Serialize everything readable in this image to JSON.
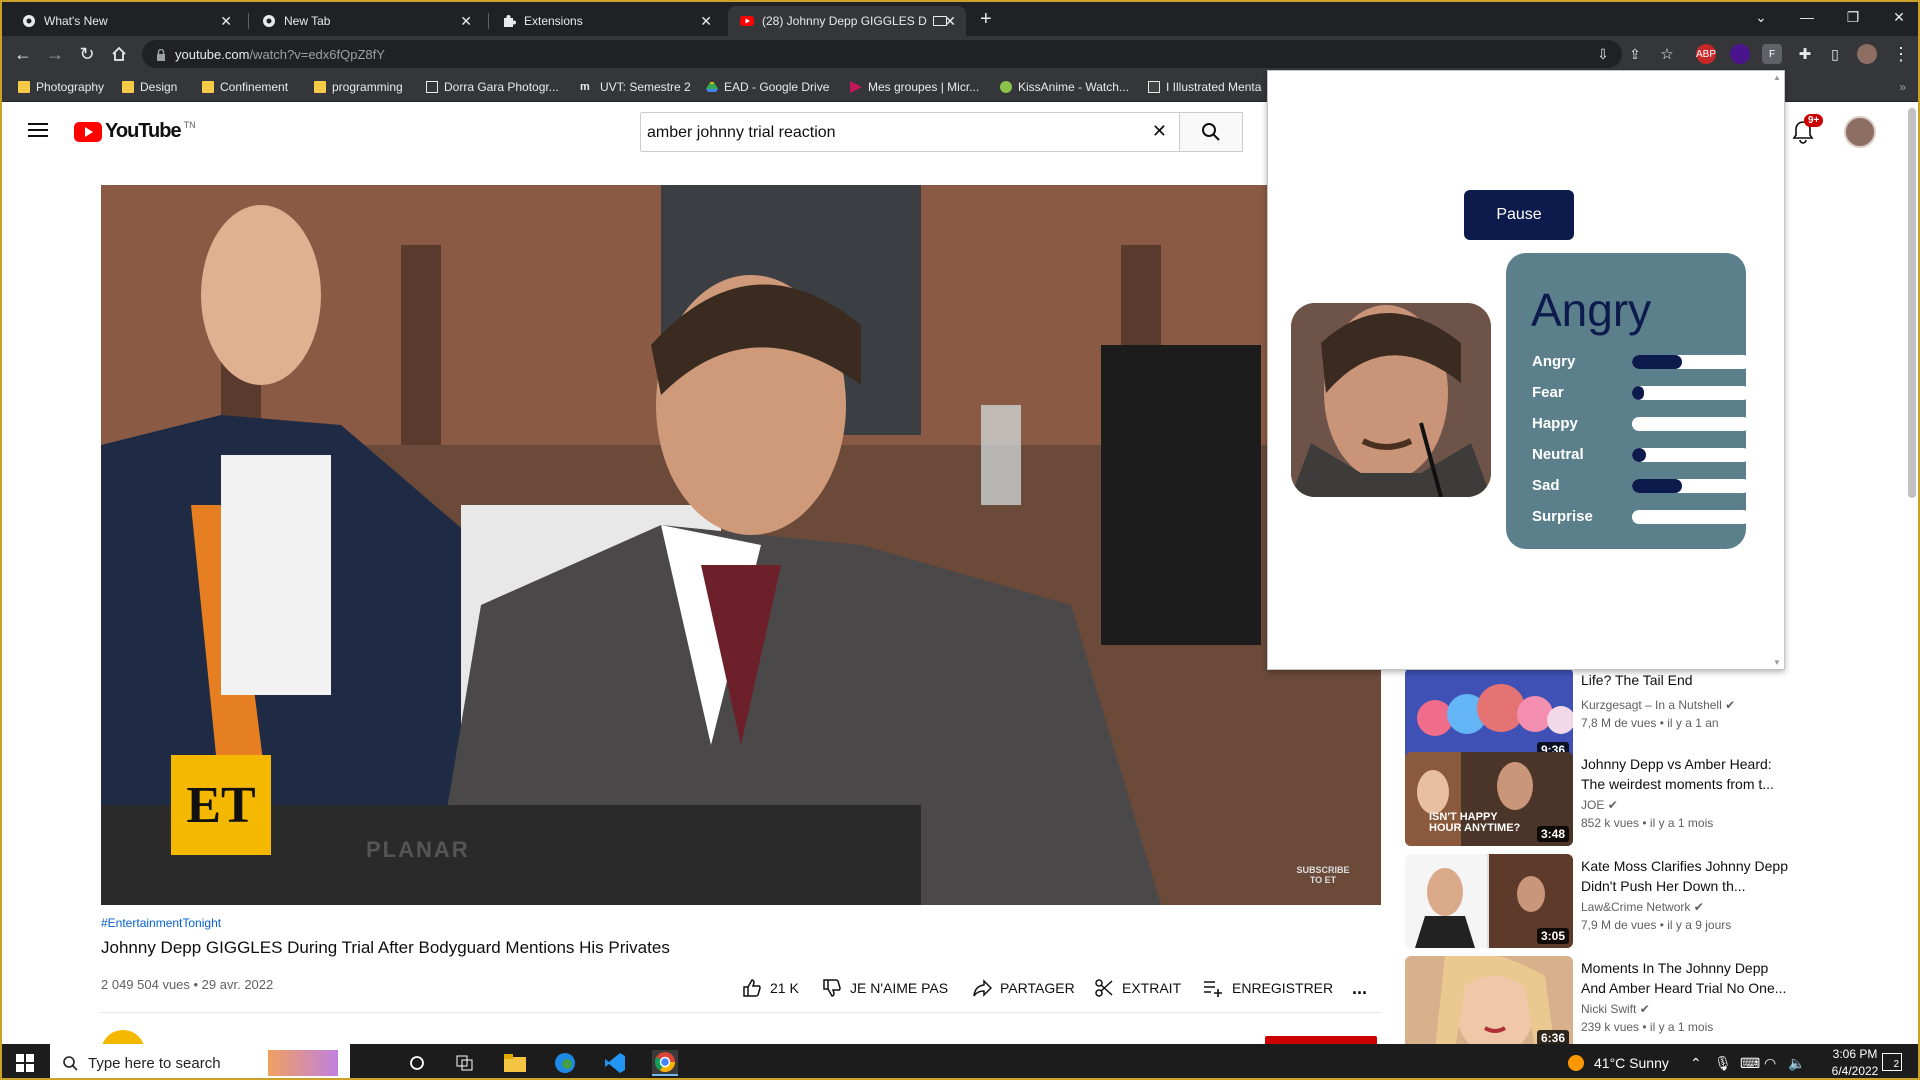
{
  "browser": {
    "tabs": [
      {
        "title": "What's New",
        "active": false
      },
      {
        "title": "New Tab",
        "active": false
      },
      {
        "title": "Extensions",
        "active": false
      },
      {
        "title": "(28) Johnny Depp GIGGLES D",
        "active": true
      }
    ],
    "new_tab_label": "+",
    "url": {
      "host": "youtube.com",
      "path": "/watch?v=edx6fQpZ8fY"
    },
    "bookmarks": [
      {
        "label": "Photography",
        "icon": "folder-icon"
      },
      {
        "label": "Design",
        "icon": "folder-icon"
      },
      {
        "label": "Confinement",
        "icon": "folder-icon"
      },
      {
        "label": "programming",
        "icon": "folder-icon"
      },
      {
        "label": "Dorra Gara Photogr...",
        "icon": "photo-icon"
      },
      {
        "label": "UVT: Semestre 2",
        "icon": "uvt-icon"
      },
      {
        "label": "EAD - Google Drive",
        "icon": "drive-icon"
      },
      {
        "label": "Mes groupes | Micr...",
        "icon": "teams-icon"
      },
      {
        "label": "KissAnime - Watch...",
        "icon": "anime-icon"
      },
      {
        "label": "I Illustrated Menta",
        "icon": "blog-icon"
      }
    ]
  },
  "youtube": {
    "logo_text": "YouTube",
    "logo_sup": "TN",
    "search_value": "amber johnny trial reaction",
    "notif_badge": "9+",
    "video": {
      "hashtag": "#EntertainmentTonight",
      "title": "Johnny Depp GIGGLES During Trial After Bodyguard Mentions His Privates",
      "views": "2 049 504 vues • 29 avr. 2022",
      "overlay_logo": "ET",
      "watermark": "SUBSCRIBE TO ET",
      "monitor_brand": "PLANAR"
    },
    "actions": {
      "like": "21 K",
      "dislike": "JE N'AIME PAS",
      "share": "PARTAGER",
      "clip": "EXTRAIT",
      "save": "ENREGISTRER",
      "more": "..."
    },
    "suggestions": [
      {
        "title": "Life? The Tail End",
        "channel": "Kurzgesagt – In a Nutshell",
        "meta": "7,8 M de vues • il y a 1 an",
        "duration": "9:36"
      },
      {
        "title": "Johnny Depp vs Amber Heard: The weirdest moments from t...",
        "channel": "JOE",
        "meta": "852 k vues • il y a 1 mois",
        "duration": "3:48",
        "thumb_text": "ISN'T HAPPY HOUR ANYTIME?"
      },
      {
        "title": "Kate Moss Clarifies Johnny Depp Didn't Push Her Down th...",
        "channel": "Law&Crime Network",
        "meta": "7,9 M de vues • il y a 9 jours",
        "duration": "3:05"
      },
      {
        "title": "Moments In The Johnny Depp And Amber Heard Trial No One...",
        "channel": "Nicki Swift",
        "meta": "239 k vues • il y a 1 mois",
        "duration": "6:36"
      }
    ]
  },
  "extension_popup": {
    "pause_label": "Pause",
    "dominant_emotion": "Angry",
    "emotions": [
      {
        "label": "Angry",
        "level": 0.42
      },
      {
        "label": "Fear",
        "level": 0.03
      },
      {
        "label": "Happy",
        "level": 0.0
      },
      {
        "label": "Neutral",
        "level": 0.12
      },
      {
        "label": "Sad",
        "level": 0.42
      },
      {
        "label": "Surprise",
        "level": 0.0
      }
    ]
  },
  "taskbar": {
    "search_placeholder": "Type here to search",
    "weather": "41°C  Sunny",
    "time": "3:06 PM",
    "date": "6/4/2022",
    "notifications": "2"
  },
  "colors": {
    "accent": "#0d1b4c",
    "panel": "#5b808b",
    "yt_red": "#ff0000"
  }
}
